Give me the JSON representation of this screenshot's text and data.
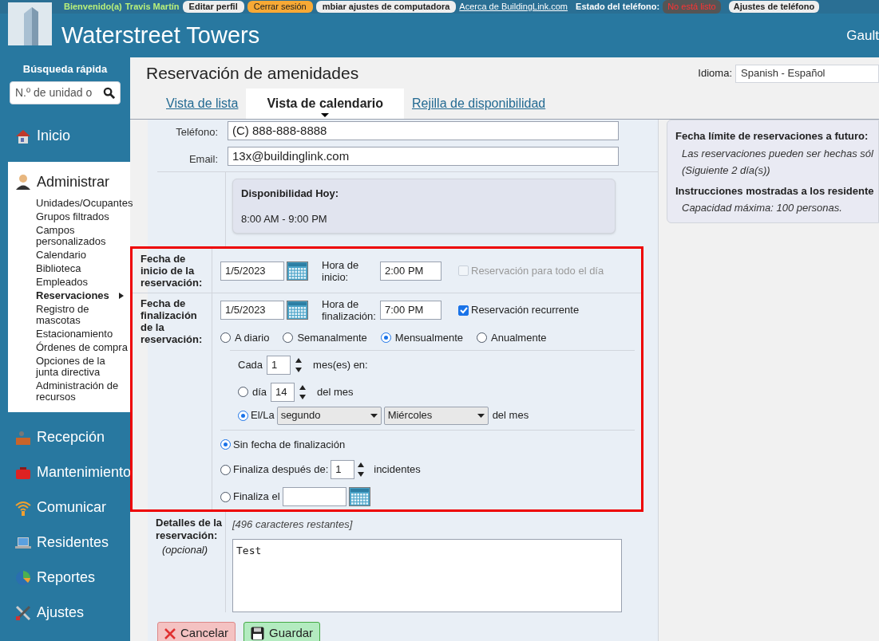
{
  "top_bar": {
    "welcome": "Bienvenido(a)",
    "user": "Travis Martín",
    "buttons": [
      {
        "label": "Editar perfil",
        "kind": "plain"
      },
      {
        "label": "Cerrar sesión",
        "kind": "accent"
      },
      {
        "label": "mbiar ajustes de computadora",
        "kind": "plain"
      }
    ],
    "link": "Acerca de BuildingLink.com",
    "phone_status_label": "Estado del teléfono:",
    "phone_status": "No está listo",
    "phone_settings": "Ajustes de teléfono"
  },
  "header": {
    "title": "Waterstreet Towers",
    "user_cut": "Gault"
  },
  "sidebar": {
    "quick_search_label": "Búsqueda rápida",
    "search_placeholder": "N.º de unidad o",
    "items": [
      {
        "label": "Inicio",
        "kind": "home",
        "expanded": false
      },
      {
        "label": "Administrar",
        "kind": "admin",
        "expanded": true,
        "children": [
          {
            "label": "Unidades/Ocupantes",
            "selected": false
          },
          {
            "label": "Grupos filtrados",
            "selected": false
          },
          {
            "label": "Campos personalizados",
            "selected": false
          },
          {
            "label": "Calendario",
            "selected": false
          },
          {
            "label": "Biblioteca",
            "selected": false
          },
          {
            "label": "Empleados",
            "selected": false
          },
          {
            "label": "Reservaciones",
            "selected": true
          },
          {
            "label": "Registro de mascotas",
            "selected": false
          },
          {
            "label": "Estacionamiento",
            "selected": false
          },
          {
            "label": "Órdenes de compra",
            "selected": false
          },
          {
            "label": "Opciones de la junta directiva",
            "selected": false
          },
          {
            "label": "Administración de recursos",
            "selected": false
          }
        ]
      },
      {
        "label": "Recepción",
        "kind": "desk",
        "expanded": false
      },
      {
        "label": "Mantenimiento",
        "kind": "toolbox",
        "expanded": false
      },
      {
        "label": "Comunicar",
        "kind": "wifi",
        "expanded": false
      },
      {
        "label": "Residentes",
        "kind": "laptop",
        "expanded": false
      },
      {
        "label": "Reportes",
        "kind": "pie",
        "expanded": false
      },
      {
        "label": "Ajustes",
        "kind": "tools",
        "expanded": false
      }
    ]
  },
  "page": {
    "title": "Reservación de amenidades",
    "language_label": "Idioma:",
    "language": "Spanish - Español",
    "tabs": [
      {
        "label": "Vista de lista",
        "selected": false
      },
      {
        "label": "Vista de calendario",
        "selected": true
      },
      {
        "label": "Rejilla de disponibilidad",
        "selected": false
      }
    ]
  },
  "form": {
    "phone_label": "Teléfono:",
    "phone": "(C) 888-888-8888",
    "email_label": "Email:",
    "email": "13x@buildinglink.com",
    "availability_title": "Disponibilidad Hoy:",
    "availability_hours": "8:00 AM - 9:00 PM",
    "start": {
      "label": "Fecha de inicio de la reservación:",
      "date": "1/5/2023",
      "time_label": "Hora de inicio:",
      "time": "2:00 PM",
      "all_day": {
        "label": "Reservación para todo el día",
        "checked": false,
        "disabled": true
      }
    },
    "end": {
      "label": "Fecha de finalización de la reservación:",
      "date": "1/5/2023",
      "time_label": "Hora de finalización:",
      "time": "7:00 PM",
      "recurring": {
        "label": "Reservación recurrente",
        "checked": true
      }
    },
    "frequency": [
      {
        "label": "A diario",
        "selected": false
      },
      {
        "label": "Semanalmente",
        "selected": false
      },
      {
        "label": "Mensualmente",
        "selected": true
      },
      {
        "label": "Anualmente",
        "selected": false
      }
    ],
    "every_label": "Cada",
    "every": "1",
    "every_suffix": "mes(es) en:",
    "day_option": {
      "label": "día",
      "value": "14",
      "suffix": "del mes",
      "selected": false
    },
    "ordinal_option": {
      "label": "El/La",
      "ordinal": "segundo",
      "weekday": "Miércoles",
      "suffix": "del mes",
      "selected": true
    },
    "end_options": [
      {
        "kind": "none",
        "label": "Sin fecha de finalización",
        "selected": true
      },
      {
        "kind": "after",
        "label": "Finaliza después de:",
        "value": "1",
        "suffix": "incidentes",
        "selected": false
      },
      {
        "kind": "date",
        "label": "Finaliza el",
        "selected": false
      }
    ],
    "details_label": "Detalles de la reservación:",
    "details_optional": "(opcional)",
    "remaining": "[496 caracteres restantes]",
    "details": "Test",
    "cancel": "Cancelar",
    "save": "Guardar"
  },
  "info_panel": [
    {
      "heading": "Fecha límite de reservaciones a futuro:",
      "lines": [
        "Las reservaciones pueden ser hechas sól",
        "(Siguiente 2 día(s))"
      ]
    },
    {
      "heading": "Instrucciones mostradas a los residente",
      "lines": [
        "Capacidad máxima: 100 personas."
      ]
    }
  ]
}
